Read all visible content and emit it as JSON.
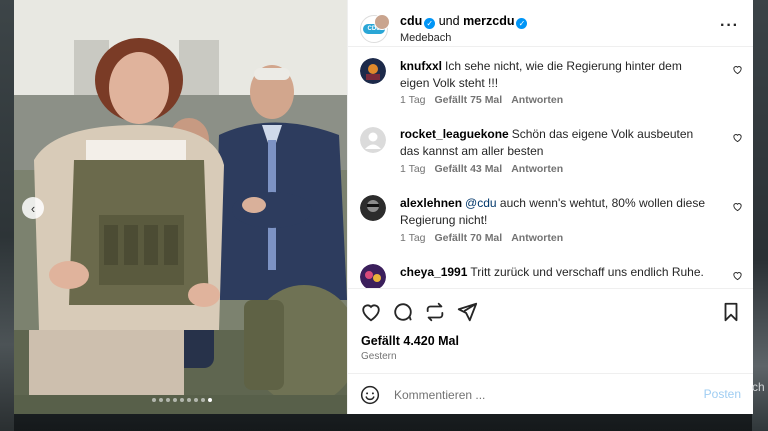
{
  "header": {
    "user1": "cdu",
    "conjunction": "und",
    "user2": "merzcdu",
    "location": "Medebach",
    "cdu_avatar_text": "CDU"
  },
  "comments": [
    {
      "username": "knufxxl",
      "text": "Ich sehe nicht, wie die Regierung hinter dem eigen Volk steht !!!",
      "time": "1 Tag",
      "likes": "Gefällt 75 Mal",
      "reply": "Antworten"
    },
    {
      "username": "rocket_leaguekone",
      "text": "Schön das eigene Volk ausbeuten das kannst am aller besten",
      "time": "1 Tag",
      "likes": "Gefällt 43 Mal",
      "reply": "Antworten"
    },
    {
      "username": "alexlehnen",
      "mention": "@cdu",
      "text": "auch wenn's wehtut, 80% wollen diese Regierung nicht!",
      "time": "1 Tag",
      "likes": "Gefällt 70 Mal",
      "reply": "Antworten"
    },
    {
      "username": "cheya_1991",
      "text": "Tritt zurück und verschaff uns endlich Ruhe."
    }
  ],
  "post": {
    "likes": "Gefällt 4.420 Mal",
    "date": "Gestern"
  },
  "composer": {
    "placeholder": "Kommentieren ...",
    "post_label": "Posten"
  },
  "edge_fragment": "ch",
  "colors": {
    "accent": "#0095f6",
    "mention": "#00376b",
    "post_disabled": "#9fcdf2"
  }
}
